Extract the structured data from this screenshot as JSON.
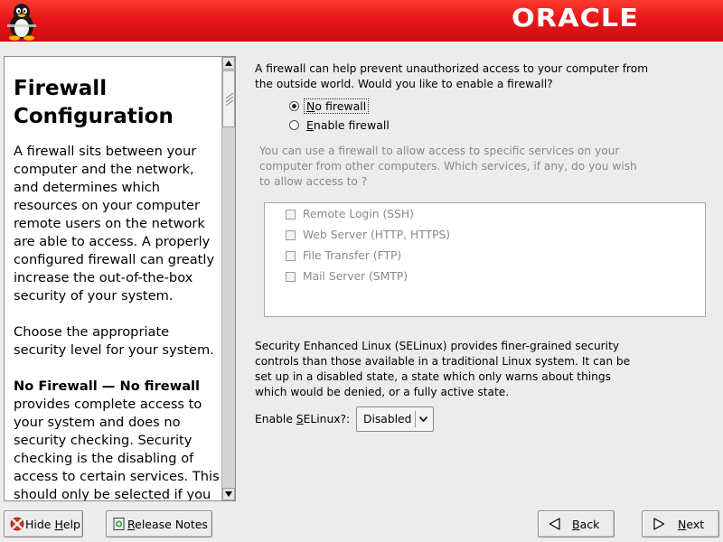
{
  "header": {
    "logo_text": "ORACLE",
    "accent_color": "#e8161b"
  },
  "help": {
    "title": "Firewall Configuration",
    "paragraphs": [
      "A firewall sits between your computer and the network, and determines which resources on your computer remote users on the network are able to access. A properly configured firewall can greatly increase the out-of-the-box security of your system.",
      "Choose the appropriate security level for your system."
    ],
    "nofw_bold": "No Firewall — No firewall",
    "nofw_rest": " provides complete access to your system and does no security checking. Security checking is the disabling of access to certain services. This should only be selected if you are running on a trusted"
  },
  "firewall": {
    "intro": "A firewall can help prevent unauthorized access to your computer from the outside world.  Would you like to enable a firewall?",
    "options": [
      {
        "mnemonic": "N",
        "rest": "o firewall",
        "selected": true
      },
      {
        "mnemonic": "E",
        "rest": "nable firewall",
        "selected": false
      }
    ]
  },
  "services": {
    "note": "You can use a firewall to allow access to specific services on your computer from other computers. Which services, if any, do you wish to allow access to ?",
    "items": [
      {
        "label": "Remote Login (SSH)",
        "checked": false
      },
      {
        "label": "Web Server (HTTP, HTTPS)",
        "checked": false
      },
      {
        "label": "File Transfer (FTP)",
        "checked": false
      },
      {
        "label": "Mail Server (SMTP)",
        "checked": false
      }
    ]
  },
  "selinux": {
    "description": "Security Enhanced Linux (SELinux) provides finer-grained security controls than those available in a traditional Linux system.  It can be set up in a disabled state, a state which only warns about things which would be denied, or a fully active state.",
    "label_pre": "Enable ",
    "label_mnemonic": "S",
    "label_post": "ELinux?:",
    "selected_value": "Disabled"
  },
  "buttons": {
    "hide_help": {
      "pre": "Hide ",
      "mnemonic": "H",
      "post": "elp"
    },
    "release_notes": {
      "mnemonic": "R",
      "post": "elease Notes"
    },
    "back": {
      "mnemonic": "B",
      "post": "ack"
    },
    "next": {
      "mnemonic": "N",
      "post": "ext"
    }
  }
}
